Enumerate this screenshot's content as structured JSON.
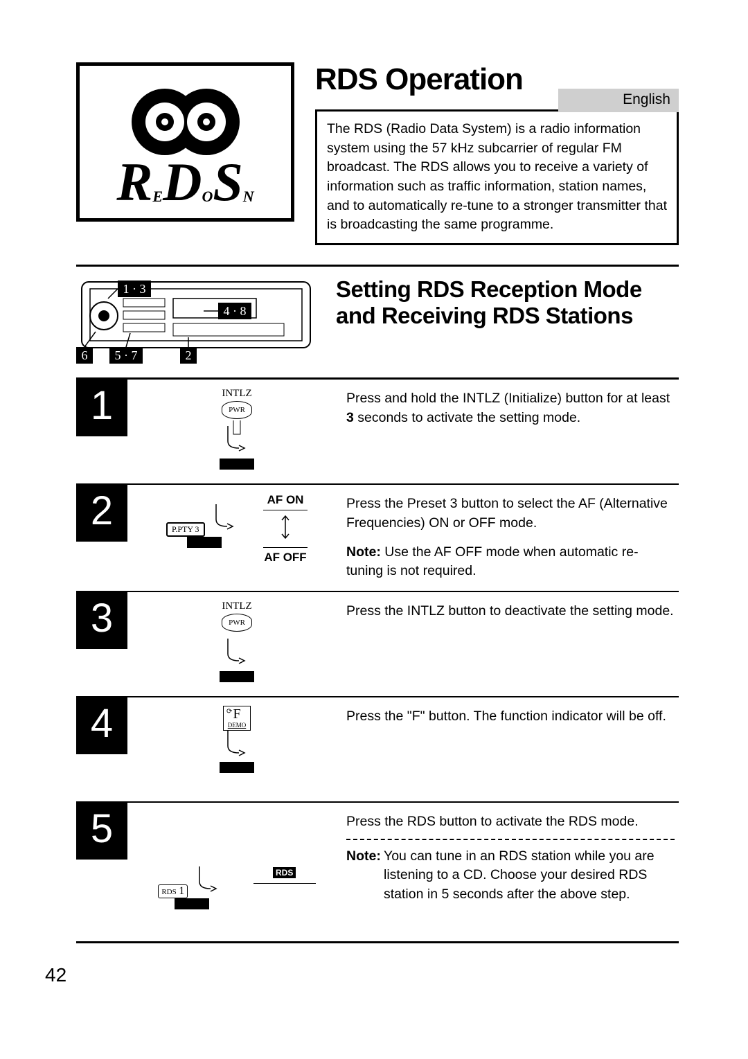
{
  "language_tag": "English",
  "main_title": "RDS Operation",
  "intro_text": "The RDS (Radio Data System) is a radio information system using the 57 kHz subcarrier of regular FM broadcast. The RDS allows you to receive a variety of information such as traffic information, station names, and to automatically re-tune to a stronger transmitter that is broadcasting the same programme.",
  "rds_logo_sub": {
    "e": "E",
    "o": "O",
    "n": "N"
  },
  "section_title": "Setting RDS Reception Mode and Receiving RDS Stations",
  "diagram": {
    "label1": "1 · 3",
    "label2": "4 · 8",
    "label3": "6",
    "label4": "5 · 7",
    "label5": "2"
  },
  "steps": [
    {
      "num": "1",
      "illus_top": "INTLZ",
      "illus_btn": "PWR",
      "text": "Press and hold the INTLZ (Initialize) button for at least ",
      "text_bold": "3",
      "text_after": " seconds to activate the setting mode."
    },
    {
      "num": "2",
      "af_on": "AF ON",
      "af_off": "AF OFF",
      "btn": "P.PTY  3",
      "text": "Press the Preset 3 button to select the AF (Alternative Frequencies) ON or OFF mode.",
      "note_label": "Note:",
      "note": "  Use the AF OFF mode when automatic re-tuning is not required."
    },
    {
      "num": "3",
      "illus_top": "INTLZ",
      "illus_btn": "PWR",
      "text": "Press the INTLZ button to deactivate the setting mode."
    },
    {
      "num": "4",
      "f_label": "F",
      "demo_label": "DEMO",
      "text": "Press the \"F\" button. The function indicator will be off."
    },
    {
      "num": "5",
      "rds_btn_label": "RDS",
      "rds_btn_num": "1",
      "rds_disp": "RDS",
      "text": "Press the RDS button to activate the RDS mode.",
      "note_label": "Note:",
      "note": "  You can tune in an RDS station while you are listening to a CD. Choose your desired RDS station in 5 seconds after the above step."
    }
  ],
  "page_number": "42"
}
